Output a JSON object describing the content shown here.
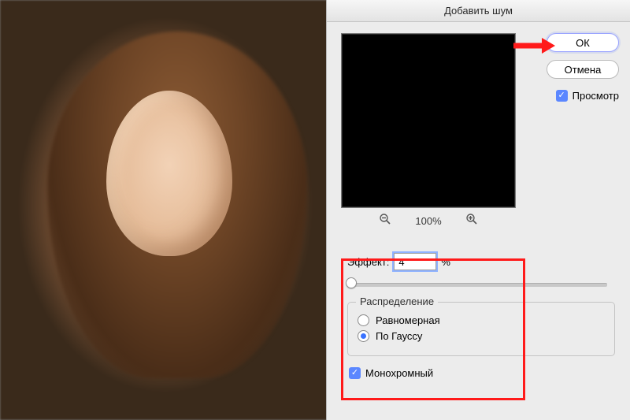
{
  "dialog": {
    "title": "Добавить шум",
    "ok_label": "ОК",
    "cancel_label": "Отмена",
    "preview_label": "Просмотр",
    "zoom_level": "100%",
    "amount_label": "Эффект:",
    "amount_value": "4",
    "amount_unit": "%",
    "distribution": {
      "legend": "Распределение",
      "uniform_label": "Равномерная",
      "gaussian_label": "По Гауссу",
      "selected": "gaussian"
    },
    "monochrome_label": "Монохромный",
    "monochrome_checked": true,
    "preview_checked": true
  },
  "colors": {
    "highlight": "#ff1a1a",
    "accent": "#5b87ff"
  }
}
